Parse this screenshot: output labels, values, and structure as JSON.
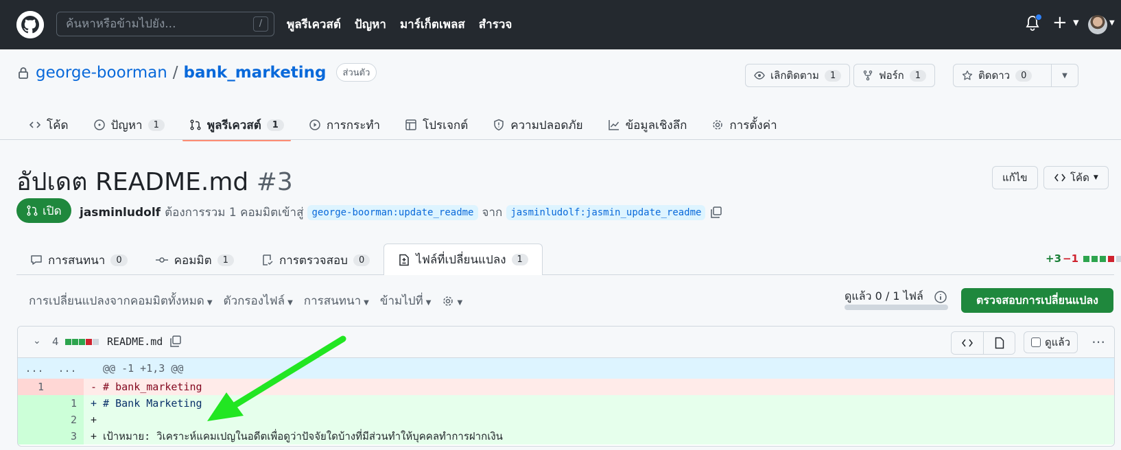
{
  "header": {
    "search_placeholder": "ค้นหาหรือข้ามไปยัง...",
    "search_shortcut": "/",
    "nav": [
      "พูลรีเควสต์",
      "ปัญหา",
      "มาร์เก็ตเพลส",
      "สำรวจ"
    ],
    "plus_label": "+"
  },
  "repo": {
    "owner": "george-boorman",
    "separator": "/",
    "name": "bank_marketing",
    "visibility": "ส่วนตัว",
    "watch_label": "เลิกติดตาม",
    "watch_count": "1",
    "fork_label": "ฟอร์ก",
    "fork_count": "1",
    "star_label": "ติดดาว",
    "star_count": "0"
  },
  "repo_nav": [
    {
      "label": "โค้ด",
      "icon": "code-icon",
      "count": ""
    },
    {
      "label": "ปัญหา",
      "icon": "issue-icon",
      "count": "1"
    },
    {
      "label": "พูลรีเควสต์",
      "icon": "pull-request-icon",
      "count": "1",
      "active": true
    },
    {
      "label": "การกระทำ",
      "icon": "play-icon",
      "count": ""
    },
    {
      "label": "โปรเจกต์",
      "icon": "table-icon",
      "count": ""
    },
    {
      "label": "ความปลอดภัย",
      "icon": "shield-icon",
      "count": ""
    },
    {
      "label": "ข้อมูลเชิงลึก",
      "icon": "graph-icon",
      "count": ""
    },
    {
      "label": "การตั้งค่า",
      "icon": "gear-icon",
      "count": ""
    }
  ],
  "pr": {
    "title": "อัปเดต README.md",
    "number": "#3",
    "edit_label": "แก้ไข",
    "code_label": "โค้ด",
    "state": "เปิด",
    "author": "jasminludolf",
    "summary": "ต้องการรวม 1 คอมมิตเข้าสู่",
    "base_branch": "george-boorman:update_readme",
    "from_word": "จาก",
    "head_branch": "jasminludolf:jasmin_update_readme"
  },
  "pr_tabs": [
    {
      "label": "การสนทนา",
      "count": "0",
      "icon": "comment-icon"
    },
    {
      "label": "คอมมิต",
      "count": "1",
      "icon": "commit-icon"
    },
    {
      "label": "การตรวจสอบ",
      "count": "0",
      "icon": "checklist-icon"
    },
    {
      "label": "ไฟล์ที่เปลี่ยนแปลง",
      "count": "1",
      "icon": "file-diff-icon",
      "active": true
    }
  ],
  "diffstat": {
    "additions": "+3",
    "deletions": "−1"
  },
  "toolbar": {
    "all_changes": "การเปลี่ยนแปลงจากคอมมิตทั้งหมด",
    "file_filter": "ตัวกรองไฟล์",
    "conversations": "การสนทนา",
    "jump_to": "ข้ามไปที่",
    "viewed_progress": "ดูแล้ว 0 / 1 ไฟล์",
    "review_button": "ตรวจสอบการเปลี่ยนแปลง"
  },
  "file": {
    "change_count": "4",
    "name": "README.md",
    "viewed_label": "ดูแล้ว",
    "hunk_left": "...",
    "hunk_right": "...",
    "hunk_header": "@@ -1 +1,3 @@",
    "lines": [
      {
        "type": "del",
        "old": "1",
        "new": "",
        "text": "- # bank_marketing"
      },
      {
        "type": "add",
        "old": "",
        "new": "1",
        "text": "+ # Bank Marketing"
      },
      {
        "type": "add",
        "old": "",
        "new": "2",
        "text": "+"
      },
      {
        "type": "add",
        "old": "",
        "new": "3",
        "text": "+ เป้าหมาย: วิเคราะห์แคมเปญในอดีตเพื่อดูว่าปัจจัยใดบ้างที่มีส่วนทำให้บุคคลทำการฝากเงิน"
      }
    ]
  },
  "colors": {
    "accent": "#1f883d",
    "link": "#0969da",
    "annotation_arrow": "#22e622"
  }
}
